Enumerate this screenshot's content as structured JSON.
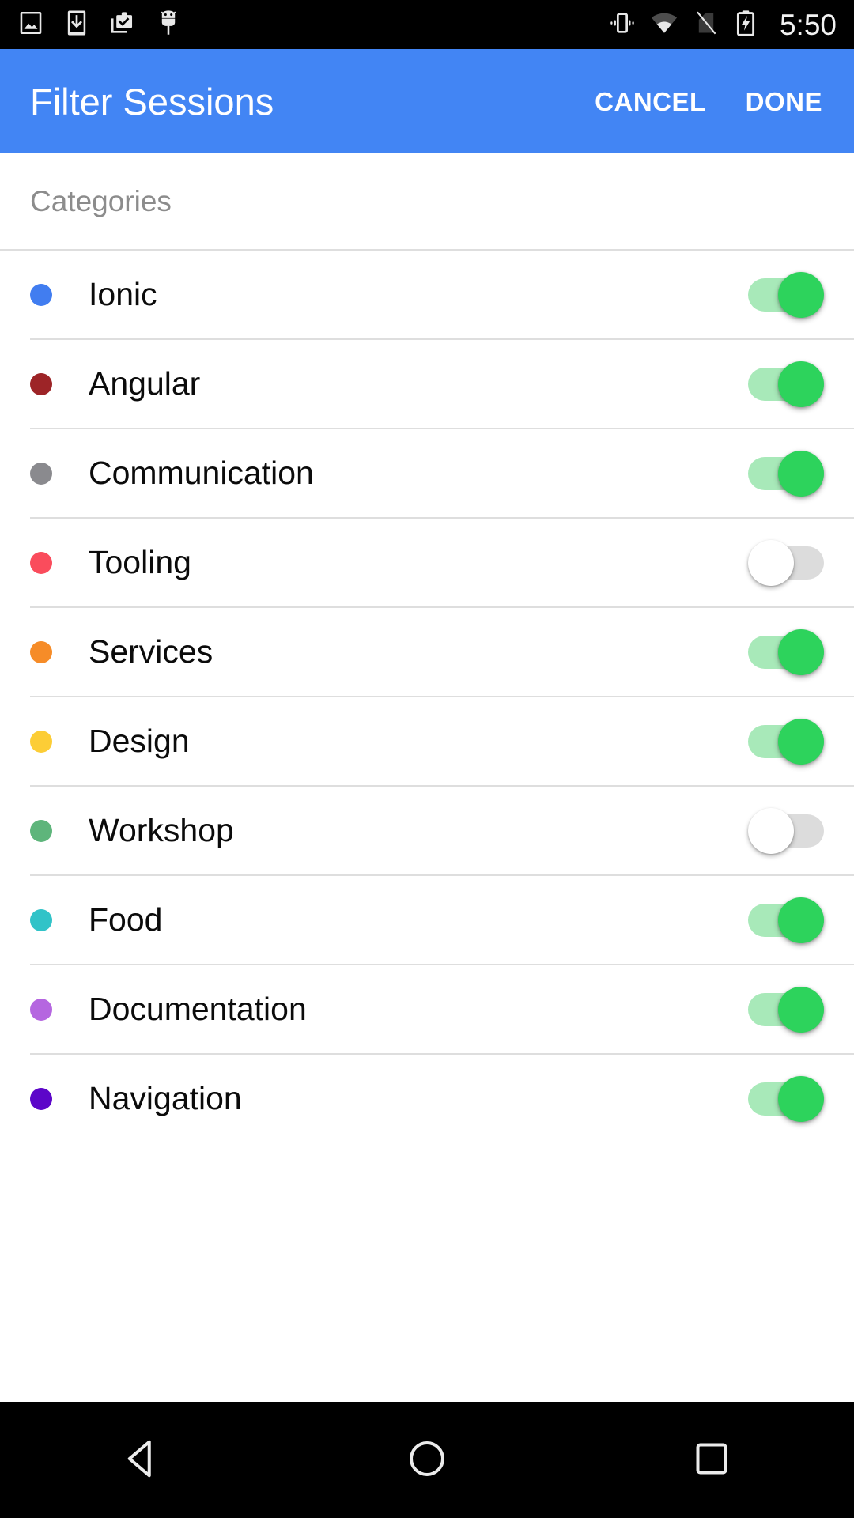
{
  "status_bar": {
    "icons_left": [
      "image-icon",
      "download-icon",
      "clipboard-check-icon",
      "android-debug-icon"
    ],
    "icons_right": [
      "vibrate-icon",
      "wifi-icon",
      "no-sim-icon",
      "battery-charging-icon"
    ],
    "time": "5:50"
  },
  "toolbar": {
    "title": "Filter Sessions",
    "cancel_label": "CANCEL",
    "done_label": "DONE",
    "background_color": "#4285f4"
  },
  "section": {
    "header": "Categories"
  },
  "categories": [
    {
      "label": "Ionic",
      "color": "#417df0",
      "enabled": true
    },
    {
      "label": "Angular",
      "color": "#9d2427",
      "enabled": true
    },
    {
      "label": "Communication",
      "color": "#8a8a8e",
      "enabled": true
    },
    {
      "label": "Tooling",
      "color": "#fa4c5c",
      "enabled": false
    },
    {
      "label": "Services",
      "color": "#f68c28",
      "enabled": true
    },
    {
      "label": "Design",
      "color": "#fccd36",
      "enabled": true
    },
    {
      "label": "Workshop",
      "color": "#5eb57b",
      "enabled": false
    },
    {
      "label": "Food",
      "color": "#31c3c8",
      "enabled": true
    },
    {
      "label": "Documentation",
      "color": "#b566e0",
      "enabled": true
    },
    {
      "label": "Navigation",
      "color": "#5c06c9",
      "enabled": true
    }
  ],
  "toggle_colors": {
    "on_track": "#a8e9b9",
    "on_thumb": "#2dd35c",
    "off_track": "#dcdcdc",
    "off_thumb": "#ffffff"
  },
  "nav_bar": {
    "back_label": "back-button",
    "home_label": "home-button",
    "recents_label": "recents-button"
  }
}
